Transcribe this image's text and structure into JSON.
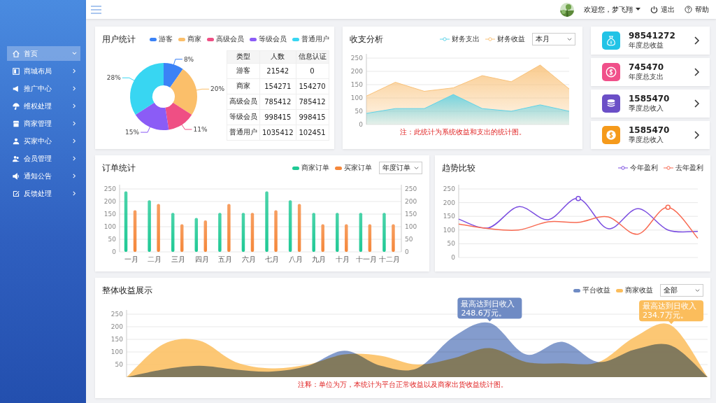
{
  "topbar": {
    "greeting": "欢迎您，梦飞翔",
    "logout": "退出",
    "help": "帮助"
  },
  "sidebar": {
    "items": [
      {
        "label": "首页",
        "selected": true
      },
      {
        "label": "商城布局",
        "selected": false
      },
      {
        "label": "推广中心",
        "selected": false
      },
      {
        "label": "维权处理",
        "selected": false
      },
      {
        "label": "商家管理",
        "selected": false
      },
      {
        "label": "买家中心",
        "selected": false
      },
      {
        "label": "会员管理",
        "selected": false
      },
      {
        "label": "通知公告",
        "selected": false
      },
      {
        "label": "反馈处理",
        "selected": false
      }
    ]
  },
  "user_stats": {
    "title": "用户统计",
    "chart_data": {
      "type": "donut",
      "categories": [
        "游客",
        "商家",
        "高级会员",
        "等级会员",
        "普通用户"
      ],
      "colors": [
        "#3b82f6",
        "#fbbf6a",
        "#ef4f84",
        "#8b5cf6",
        "#38d6f2"
      ],
      "values": [
        8,
        20,
        11,
        15,
        28
      ],
      "value_labels": [
        "8%",
        "20%",
        "11%",
        "15%",
        "28%"
      ]
    },
    "table": {
      "columns": [
        "类型",
        "人数",
        "信息认证"
      ],
      "rows": [
        [
          "游客",
          "21542",
          "0"
        ],
        [
          "商家",
          "154271",
          "154270"
        ],
        [
          "高级会员",
          "785412",
          "785412"
        ],
        [
          "等级会员",
          "998415",
          "998415"
        ],
        [
          "普通用户",
          "1035412",
          "102451"
        ]
      ]
    }
  },
  "finance": {
    "title": "收支分析",
    "select": "本月",
    "note": "注：此统计为系统收益和支出的统计图。",
    "chart_data": {
      "type": "area",
      "grid": true,
      "ylim": [
        0,
        250
      ],
      "yticks": [
        0,
        50,
        100,
        150,
        200,
        250
      ],
      "series": [
        {
          "name": "财务支出",
          "color": "#5fd3e8",
          "values": [
            42,
            60,
            60,
            113,
            60,
            50,
            74,
            50
          ]
        },
        {
          "name": "财务收益",
          "color": "#f9c27a",
          "values": [
            107,
            159,
            125,
            138,
            184,
            161,
            224,
            134
          ]
        }
      ]
    }
  },
  "stats": [
    {
      "value": "98541272",
      "label": "年度总收益",
      "color": "#22c3e6"
    },
    {
      "value": "745470",
      "label": "年度总支出",
      "color": "#f0508a"
    },
    {
      "value": "1585470",
      "label": "季度总收入",
      "color": "#6b4fc7"
    },
    {
      "value": "1585470",
      "label": "季度总收入",
      "color": "#f59a1b"
    }
  ],
  "orders": {
    "title": "订单统计",
    "select": "年度订单",
    "chart_data": {
      "type": "bar",
      "grid": true,
      "categories": [
        "一月",
        "二月",
        "三月",
        "四月",
        "五月",
        "六月",
        "七月",
        "八月",
        "九月",
        "十月",
        "十一月",
        "十二月"
      ],
      "ylim": [
        0,
        250
      ],
      "yticks": [
        0,
        50,
        100,
        150,
        200,
        250
      ],
      "y2lim": [
        0,
        250
      ],
      "y2ticks": [
        0,
        50,
        100,
        150,
        200,
        250
      ],
      "series": [
        {
          "name": "商家订单",
          "color": "#1fc995",
          "values": [
            240,
            205,
            155,
            135,
            155,
            155,
            240,
            205,
            155,
            155,
            155,
            155
          ]
        },
        {
          "name": "买家订单",
          "color": "#f5873a",
          "values": [
            165,
            190,
            110,
            125,
            190,
            155,
            165,
            190,
            110,
            110,
            110,
            110
          ]
        }
      ]
    }
  },
  "trend": {
    "title": "趋势比较",
    "chart_data": {
      "type": "line",
      "grid": true,
      "ylim": [
        0,
        250
      ],
      "yticks": [
        0,
        50,
        100,
        150,
        200,
        250
      ],
      "series": [
        {
          "name": "今年盈利",
          "color": "#7b4ee0",
          "values": [
            140,
            108,
            185,
            138,
            215,
            105,
            178,
            100,
            95
          ]
        },
        {
          "name": "去年盈利",
          "color": "#f86a52",
          "values": [
            122,
            105,
            100,
            130,
            128,
            148,
            85,
            183,
            70
          ]
        }
      ]
    }
  },
  "income": {
    "title": "整体收益展示",
    "select": "全部",
    "note": "注释：单位为万，本统计为平台正常收益以及商家出货收益统计图。",
    "chart_data": {
      "type": "area",
      "grid": true,
      "ylim": [
        0,
        250
      ],
      "yticks": [
        50,
        100,
        150,
        200,
        250
      ],
      "series": [
        {
          "name": "平台收益",
          "color": "#6f8bc4",
          "values": [
            0,
            30,
            45,
            30,
            22,
            45,
            105,
            45,
            35,
            160,
            215,
            90,
            140,
            60,
            110,
            125,
            0
          ]
        },
        {
          "name": "商家收益",
          "color": "#fbbd5c",
          "values": [
            0,
            130,
            145,
            60,
            35,
            50,
            90,
            85,
            50,
            75,
            115,
            60,
            55,
            60,
            160,
            205,
            0
          ]
        }
      ],
      "annotations": [
        {
          "y": 215,
          "text": "最高达到日收入\n248.6万元。"
        },
        {
          "y": 205,
          "text": "最高达到日收入\n234.7万元。"
        }
      ]
    }
  }
}
